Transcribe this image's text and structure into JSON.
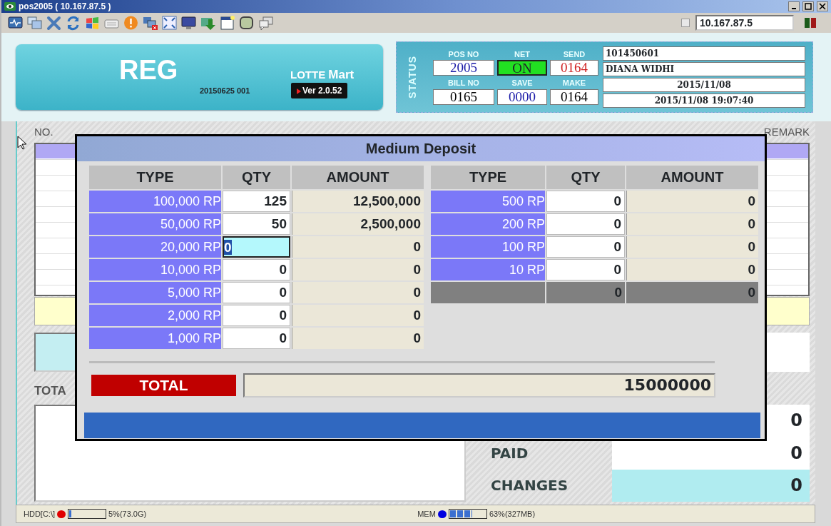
{
  "window": {
    "title": "pos2005 ( 10.167.87.5 )"
  },
  "toolbar": {
    "ip_checkbox": {
      "checked": false
    },
    "ip_address": "10.167.87.5"
  },
  "header": {
    "mode": "REG",
    "brand_left": "LOTTE",
    "brand_right": "Mart",
    "build": "20150625 001",
    "version": "Ver 2.0.52"
  },
  "status": {
    "label": "STATUS",
    "fields": [
      {
        "label": "POS NO",
        "value": "2005",
        "kind": "number",
        "color": "#1a1aa8"
      },
      {
        "label": "NET",
        "value": "ON",
        "kind": "indicator",
        "on": true
      },
      {
        "label": "SEND",
        "value": "0164",
        "kind": "number",
        "color": "#d02020"
      },
      {
        "label": "BILL NO",
        "value": "0165",
        "kind": "number",
        "color": "#000000"
      },
      {
        "label": "SAVE",
        "value": "0000",
        "kind": "number",
        "color": "#1a1aa8"
      },
      {
        "label": "MAKE",
        "value": "0164",
        "kind": "number",
        "color": "#000000"
      }
    ],
    "info": [
      "101450601",
      "DIANA WIDHI",
      "2015/11/08",
      "2015/11/08 19:07:40"
    ]
  },
  "sales_grid": {
    "columns": [
      "NO.",
      "REMARK"
    ]
  },
  "totals": {
    "label": "TOTA",
    "rows": [
      {
        "value": "0",
        "highlighted": false
      },
      {
        "label": "PAID",
        "value": "0",
        "highlighted": false
      },
      {
        "label": "CHANGES",
        "value": "0",
        "highlighted": true
      }
    ]
  },
  "status_bar": [
    {
      "label": "HDD[C:\\]",
      "color": "#e00000",
      "level": 0.05,
      "reading": "5%(73.0G)"
    },
    {
      "label": "MEM",
      "color": "#0000e0",
      "level": 0.63,
      "reading": "63%(327MB)"
    }
  ],
  "dialog": {
    "title": "Medium Deposit",
    "tables": [
      {
        "columns": [
          "TYPE",
          "QTY",
          "AMOUNT"
        ],
        "rows": [
          {
            "type": "100,000 RP",
            "qty": "125",
            "amount": "12,500,000",
            "focused": false
          },
          {
            "type": "50,000 RP",
            "qty": "50",
            "amount": "2,500,000",
            "focused": false
          },
          {
            "type": "20,000 RP",
            "qty": "0",
            "amount": "0",
            "focused": true
          },
          {
            "type": "10,000 RP",
            "qty": "0",
            "amount": "0",
            "focused": false
          },
          {
            "type": "5,000 RP",
            "qty": "0",
            "amount": "0",
            "focused": false
          },
          {
            "type": "2,000 RP",
            "qty": "0",
            "amount": "0",
            "focused": false
          },
          {
            "type": "1,000 RP",
            "qty": "0",
            "amount": "0",
            "focused": false
          }
        ]
      },
      {
        "columns": [
          "TYPE",
          "QTY",
          "AMOUNT"
        ],
        "rows": [
          {
            "type": "500 RP",
            "qty": "0",
            "amount": "0",
            "focused": false
          },
          {
            "type": "200 RP",
            "qty": "0",
            "amount": "0",
            "focused": false
          },
          {
            "type": "100 RP",
            "qty": "0",
            "amount": "0",
            "focused": false
          },
          {
            "type": "10 RP",
            "qty": "0",
            "amount": "0",
            "focused": false
          }
        ],
        "subtotal": {
          "qty": "0",
          "amount": "0"
        }
      }
    ],
    "total": {
      "label": "TOTAL",
      "value": "15000000"
    }
  }
}
